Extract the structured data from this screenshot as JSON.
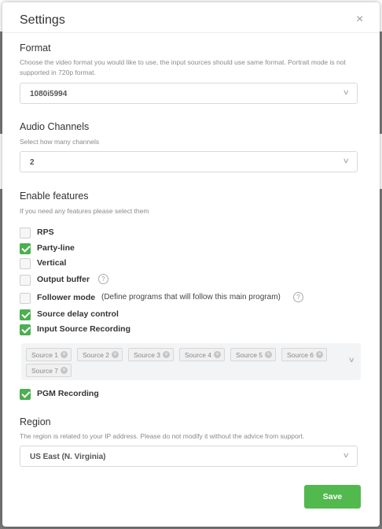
{
  "dialog": {
    "title": "Settings",
    "close_glyph": "×"
  },
  "format": {
    "title": "Format",
    "help": "Choose the video format you would like to use, the input sources should use same format. Portrait mode is not supported in 720p format.",
    "value": "1080i5994"
  },
  "audio": {
    "title": "Audio Channels",
    "help": "Select how many channels",
    "value": "2"
  },
  "features": {
    "title": "Enable features",
    "help": "If you need any features please select them",
    "items": [
      {
        "label": "RPS",
        "checked": false
      },
      {
        "label": "Party-line",
        "checked": true
      },
      {
        "label": "Vertical",
        "checked": false
      },
      {
        "label": "Output buffer",
        "checked": false,
        "help_icon": "question-icon"
      },
      {
        "label": "Follower mode",
        "checked": false,
        "note": "(Define programs that will follow this main program)",
        "help_icon": "question-icon"
      },
      {
        "label": "Source delay control",
        "checked": true
      },
      {
        "label": "Input Source Recording",
        "checked": true
      }
    ],
    "sources": [
      "Source 1",
      "Source 2",
      "Source 3",
      "Source 4",
      "Source 5",
      "Source 6",
      "Source 7"
    ],
    "pgm": {
      "label": "PGM Recording",
      "checked": true
    }
  },
  "region": {
    "title": "Region",
    "help": "The region is related to your IP address. Please do not modify it without the advice from support.",
    "value": "US East (N. Virginia)"
  },
  "actions": {
    "save_label": "Save"
  },
  "colors": {
    "accent": "#52b94e",
    "checkbox_checked": "#4caf50"
  }
}
